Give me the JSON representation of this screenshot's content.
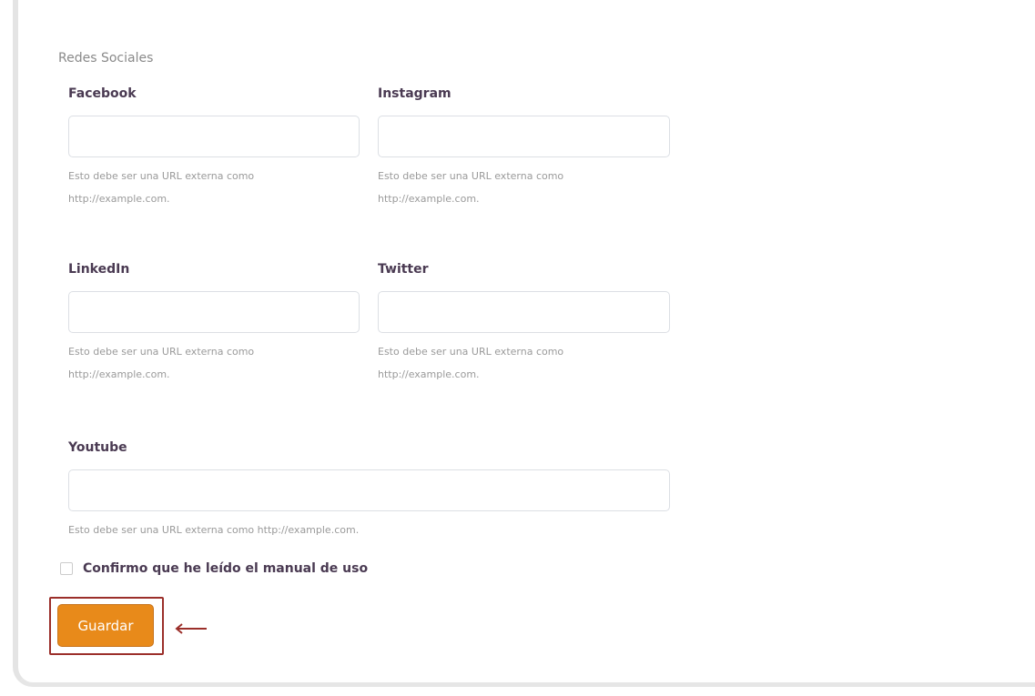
{
  "section_title": "Redes Sociales",
  "fields": {
    "facebook": {
      "label": "Facebook",
      "value": "",
      "help": "Esto debe ser una URL externa como http://example.com."
    },
    "instagram": {
      "label": "Instagram",
      "value": "",
      "help": "Esto debe ser una URL externa como http://example.com."
    },
    "linkedin": {
      "label": "LinkedIn",
      "value": "",
      "help": "Esto debe ser una URL externa como http://example.com."
    },
    "twitter": {
      "label": "Twitter",
      "value": "",
      "help": "Esto debe ser una URL externa como http://example.com."
    },
    "youtube": {
      "label": "Youtube",
      "value": "",
      "help": "Esto debe ser una URL externa como http://example.com."
    }
  },
  "confirm": {
    "label": "Confirmo que he leído el manual de uso",
    "checked": false
  },
  "save_button": {
    "label": "Guardar"
  },
  "annotation": {
    "icon": "left-arrow-icon",
    "color": "#9b2f2a"
  },
  "colors": {
    "accent": "#e88a1a",
    "highlight": "#9b2f2a",
    "label_text": "#4a3a52",
    "help_text": "#9a9a9a"
  }
}
